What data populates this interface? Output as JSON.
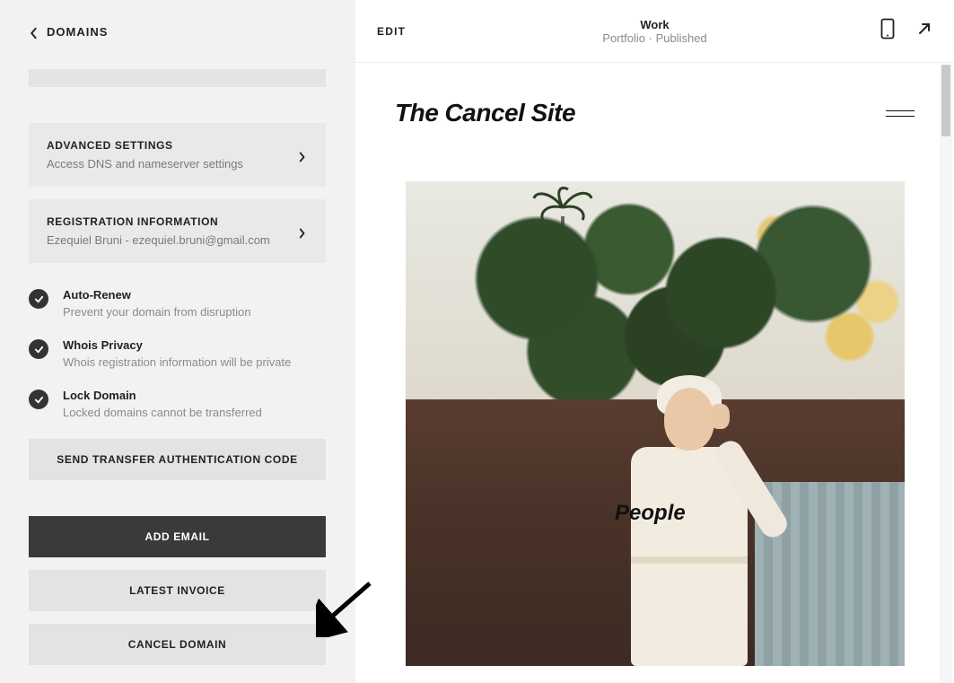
{
  "sidebar": {
    "back_label": "DOMAINS",
    "panels": [
      {
        "title": "ADVANCED SETTINGS",
        "sub": "Access DNS and nameserver settings"
      },
      {
        "title": "REGISTRATION INFORMATION",
        "sub": "Ezequiel Bruni - ezequiel.bruni@gmail.com"
      }
    ],
    "toggles": [
      {
        "title": "Auto-Renew",
        "sub": "Prevent your domain from disruption"
      },
      {
        "title": "Whois Privacy",
        "sub": "Whois registration information will be private"
      },
      {
        "title": "Lock Domain",
        "sub": "Locked domains cannot be transferred"
      }
    ],
    "buttons": {
      "transfer": "SEND TRANSFER AUTHENTICATION CODE",
      "add_email": "ADD EMAIL",
      "latest_invoice": "LATEST INVOICE",
      "cancel_domain": "CANCEL DOMAIN"
    }
  },
  "preview": {
    "edit_label": "EDIT",
    "page_title": "Work",
    "page_sub": "Portfolio · Published",
    "site_title": "The Cancel Site",
    "hero_label": "People"
  }
}
